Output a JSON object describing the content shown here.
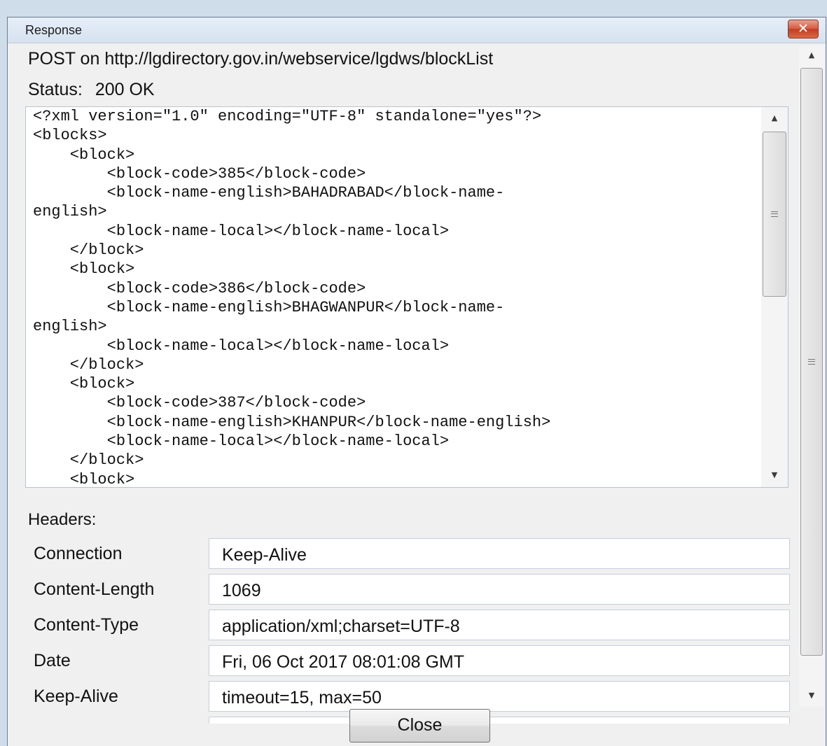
{
  "window": {
    "title": "Response"
  },
  "response": {
    "request_line": "POST on http://lgdirectory.gov.in/webservice/lgdws/blockList",
    "status_label": "Status:",
    "status_value": "200 OK",
    "body_lines": [
      "<?xml version=\"1.0\" encoding=\"UTF-8\" standalone=\"yes\"?>",
      "<blocks>",
      "    <block>",
      "        <block-code>385</block-code>",
      "        <block-name-english>BAHADRABAD</block-name-",
      "english>",
      "        <block-name-local></block-name-local>",
      "    </block>",
      "    <block>",
      "        <block-code>386</block-code>",
      "        <block-name-english>BHAGWANPUR</block-name-",
      "english>",
      "        <block-name-local></block-name-local>",
      "    </block>",
      "    <block>",
      "        <block-code>387</block-code>",
      "        <block-name-english>KHANPUR</block-name-english>",
      "        <block-name-local></block-name-local>",
      "    </block>",
      "    <block>"
    ]
  },
  "headers": {
    "label": "Headers:",
    "rows": [
      {
        "name": "Connection",
        "value": "Keep-Alive"
      },
      {
        "name": "Content-Length",
        "value": "1069"
      },
      {
        "name": "Content-Type",
        "value": "application/xml;charset=UTF-8"
      },
      {
        "name": "Date",
        "value": "Fri, 06 Oct 2017 08:01:08 GMT"
      },
      {
        "name": "Keep-Alive",
        "value": "timeout=15, max=50"
      }
    ]
  },
  "buttons": {
    "close_label": "Close"
  },
  "icons": {
    "window_close": "close-icon",
    "scroll_up": "chevron-up-icon",
    "scroll_down": "chevron-down-icon"
  },
  "colors": {
    "titlebar": "#dde7f3",
    "close_red": "#c94a30",
    "field_bg": "#ffffff"
  }
}
